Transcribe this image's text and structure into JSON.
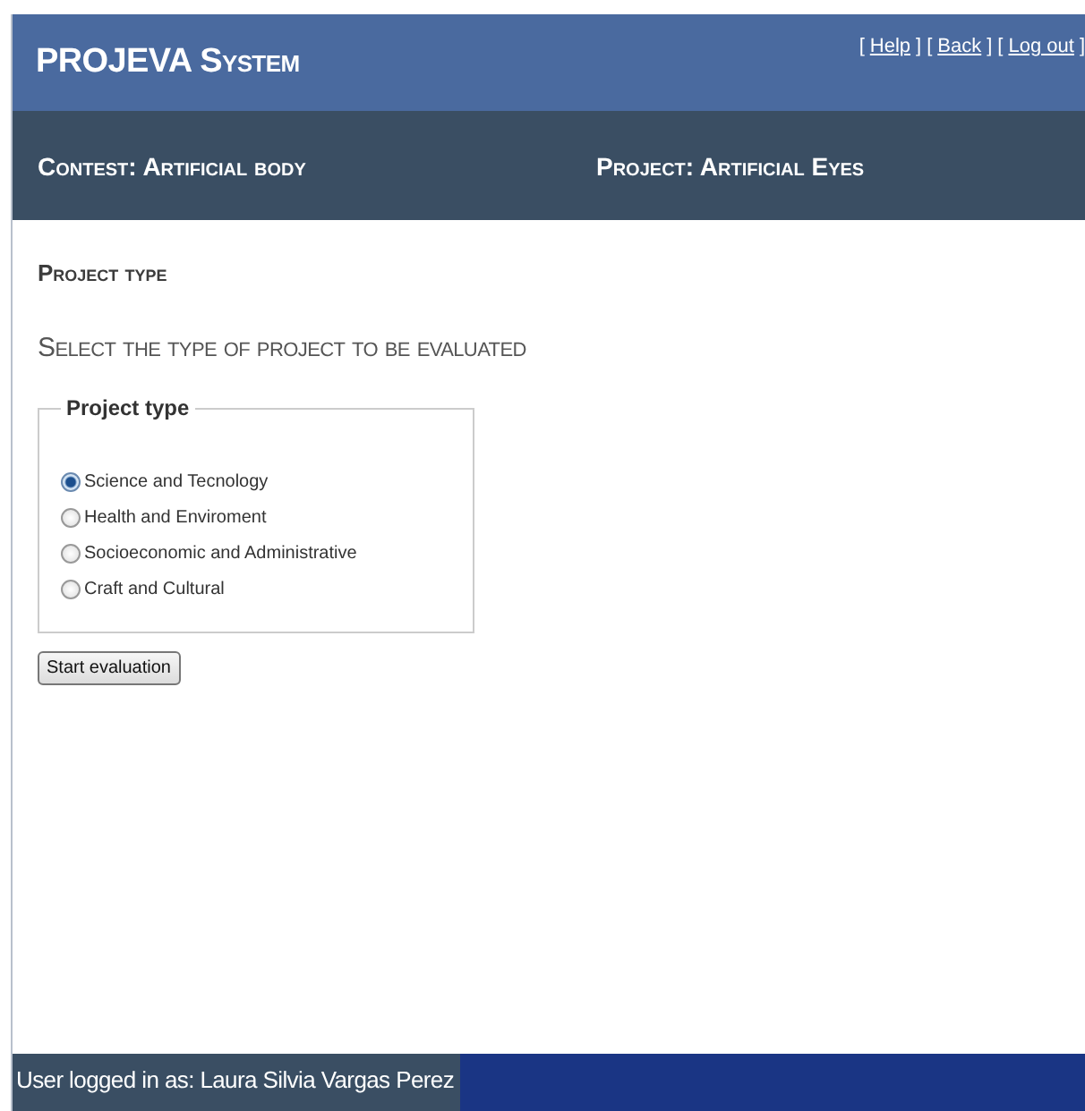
{
  "header": {
    "title": "PROJEVA System",
    "bracket_open": "[",
    "bracket_close": "]",
    "links": [
      {
        "label": "Help"
      },
      {
        "label": "Back"
      },
      {
        "label": "Log out"
      }
    ]
  },
  "context_bar": {
    "contest": "Contest: Artificial body",
    "project": "Project: Artificial Eyes"
  },
  "section_title": "Project type",
  "instruction": "Select the type of project to be evaluated",
  "fieldset": {
    "legend": "Project type",
    "options": [
      {
        "label": "Science and Tecnology",
        "selected": true
      },
      {
        "label": "Health and Enviroment",
        "selected": false
      },
      {
        "label": "Socioeconomic and Administrative",
        "selected": false
      },
      {
        "label": "Craft and Cultural",
        "selected": false
      }
    ]
  },
  "button": "Start evaluation",
  "status_bar": "User logged in as: Laura Silvia Vargas Perez"
}
